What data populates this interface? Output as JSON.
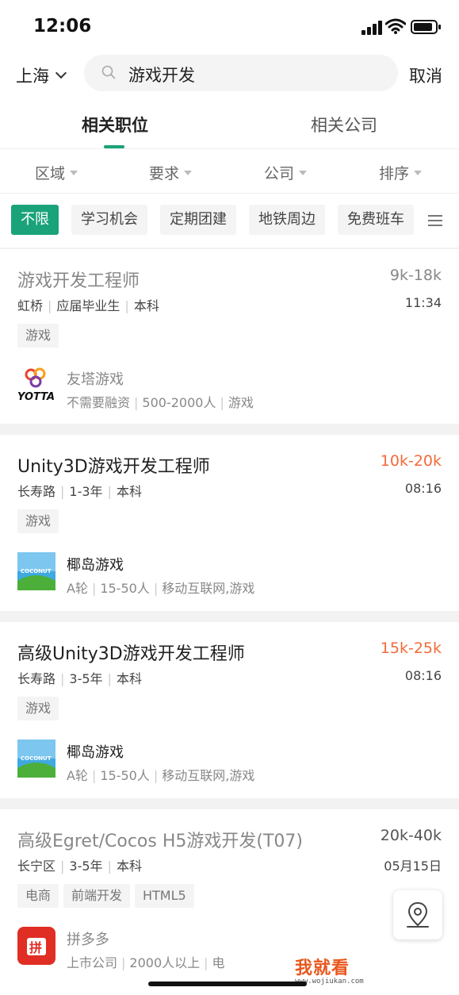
{
  "status_bar": {
    "time": "12:06"
  },
  "search": {
    "city": "上海",
    "query": "游戏开发",
    "cancel_label": "取消"
  },
  "tabs": [
    {
      "label": "相关职位",
      "active": true
    },
    {
      "label": "相关公司",
      "active": false
    }
  ],
  "filters": [
    "区域",
    "要求",
    "公司",
    "排序"
  ],
  "chips": [
    {
      "label": "不限",
      "selected": true
    },
    {
      "label": "学习机会",
      "selected": false
    },
    {
      "label": "定期团建",
      "selected": false
    },
    {
      "label": "地铁周边",
      "selected": false
    },
    {
      "label": "免费班车",
      "selected": false
    }
  ],
  "jobs": [
    {
      "title": "游戏开发工程师",
      "salary": "9k-18k",
      "location": "虹桥",
      "experience": "应届毕业生",
      "education": "本科",
      "time": "11:34",
      "tags": [
        "游戏"
      ],
      "company": {
        "name": "友塔游戏",
        "funding": "不需要融资",
        "size": "500-2000人",
        "industry": "游戏",
        "logo_text": "YOTTA"
      },
      "salary_color": "#888888"
    },
    {
      "title": "Unity3D游戏开发工程师",
      "salary": "10k-20k",
      "location": "长寿路",
      "experience": "1-3年",
      "education": "本科",
      "time": "08:16",
      "tags": [
        "游戏"
      ],
      "company": {
        "name": "椰岛游戏",
        "funding": "A轮",
        "size": "15-50人",
        "industry": "移动互联网,游戏",
        "logo_text": "COCONUT"
      },
      "salary_color": "#f26b3a"
    },
    {
      "title": "高级Unity3D游戏开发工程师",
      "salary": "15k-25k",
      "location": "长寿路",
      "experience": "3-5年",
      "education": "本科",
      "time": "08:16",
      "tags": [
        "游戏"
      ],
      "company": {
        "name": "椰岛游戏",
        "funding": "A轮",
        "size": "15-50人",
        "industry": "移动互联网,游戏",
        "logo_text": "COCONUT"
      },
      "salary_color": "#f26b3a"
    },
    {
      "title": "高级Egret/Cocos H5游戏开发(T07)",
      "salary": "20k-40k",
      "location": "长宁区",
      "experience": "3-5年",
      "education": "本科",
      "time": "05月15日",
      "tags": [
        "电商",
        "前端开发",
        "HTML5"
      ],
      "company": {
        "name": "拼多多",
        "funding": "上市公司",
        "size": "2000人以上",
        "industry": "电",
        "logo_text": "拼"
      },
      "salary_color": "#555555"
    }
  ],
  "watermark": {
    "main": "我就看",
    "sub": "www.wojiukan.com"
  },
  "colors": {
    "accent": "#1aa37a",
    "salary_highlight": "#f26b3a"
  }
}
